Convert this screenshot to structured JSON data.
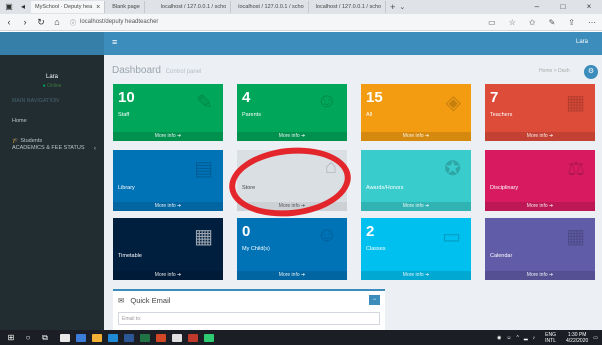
{
  "browser": {
    "tabs": [
      {
        "title": "MySchool · Deputy hea",
        "active": true
      },
      {
        "title": "Blank page",
        "active": false
      },
      {
        "title": "localhost / 127.0.0.1 / scho",
        "active": false
      },
      {
        "title": "localhost / 127.0.0.1 / scho",
        "active": false
      },
      {
        "title": "localhost / 127.0.0.1 / scho",
        "active": false
      }
    ],
    "url": "localhost/deputy headteacher"
  },
  "header": {
    "user_name": "Lara"
  },
  "sidebar": {
    "user_name": "Lara",
    "status": "Online",
    "section_header": "MAIN NAVIGATION",
    "items": [
      {
        "label": "Home"
      },
      {
        "label": "Students"
      },
      {
        "label": "ACADEMICS & FEE STATUS"
      }
    ]
  },
  "page": {
    "title": "Dashboard",
    "subtitle": "Control panel",
    "breadcrumb": "Home > Dash"
  },
  "tiles": [
    {
      "number": "10",
      "label": "Staff",
      "footer": "More info",
      "color": "#00a65a",
      "icon": "staff-icon"
    },
    {
      "number": "4",
      "label": "Parents",
      "footer": "More info",
      "color": "#00a65a",
      "icon": "parents-icon"
    },
    {
      "number": "15",
      "label": "All",
      "footer": "More info",
      "color": "#f39c12",
      "icon": "eye-icon"
    },
    {
      "number": "7",
      "label": "Teachers",
      "footer": "More info",
      "color": "#dd4b39",
      "icon": "teacher-icon"
    },
    {
      "number": "",
      "label": "Library",
      "footer": "More info",
      "color": "#0073b7",
      "icon": "book-icon"
    },
    {
      "number": "",
      "label": "Store",
      "footer": "More info",
      "color": "#dadfe3",
      "icon": "store-icon"
    },
    {
      "number": "",
      "label": "Awards/Honors",
      "footer": "More info",
      "color": "#39cccc",
      "icon": "award-icon"
    },
    {
      "number": "",
      "label": "Disciplinary",
      "footer": "More info",
      "color": "#d81b60",
      "icon": "disciplinary-icon"
    },
    {
      "number": "",
      "label": "Timetable",
      "footer": "More info",
      "color": "#001f3f",
      "icon": "calendar-icon"
    },
    {
      "number": "0",
      "label": "My Child(s)",
      "footer": "More info",
      "color": "#0073b7",
      "icon": "child-icon"
    },
    {
      "number": "2",
      "label": "Classes",
      "footer": "More info",
      "color": "#00c0ef",
      "icon": "classes-icon"
    },
    {
      "number": "",
      "label": "Calendar",
      "footer": "More info",
      "color": "#605ca8",
      "icon": "calendar-icon"
    }
  ],
  "quick_email": {
    "title": "Quick Email",
    "placeholder": "Email to:"
  },
  "taskbar": {
    "lang": "ENG",
    "region": "INTL",
    "time": "1:30 PM",
    "date": "4/22/2020"
  }
}
